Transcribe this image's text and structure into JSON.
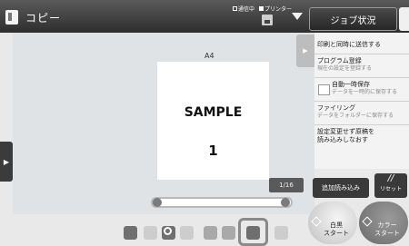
{
  "topbar": {
    "app_title": "コピー",
    "status_online": "通信中",
    "status_printer": "プリンター",
    "job_status_label": "ジョブ状況"
  },
  "preview": {
    "paper_size": "A4",
    "sample_text": "SAMPLE",
    "page_number_text": "1",
    "page_counter": "1/16"
  },
  "right_panel": {
    "items": [
      {
        "label": "印刷と同時に送信する"
      },
      {
        "label": "プログラム登録",
        "sub": "現在の設定を登録する"
      },
      {
        "label": "自動一時保存",
        "sub": "データを一時的に保存する"
      },
      {
        "label": "ファイリング",
        "sub": "データをフォルダーに保存する"
      },
      {
        "label": "設定変更せず原稿を",
        "label2": "読み込みしなおす"
      }
    ]
  },
  "buttons": {
    "add_scan": "追加読み込み",
    "reset": "リセット",
    "reset_icon": "//",
    "bw_start_1": "白黒",
    "bw_start_2": "スタート",
    "color_start_1": "カラー",
    "color_start_2": "スタート"
  },
  "colors": {
    "topbar": "#3a3a3a",
    "preview_bg": "#dfe3e5",
    "panel_bg": "#f3f3f3"
  }
}
